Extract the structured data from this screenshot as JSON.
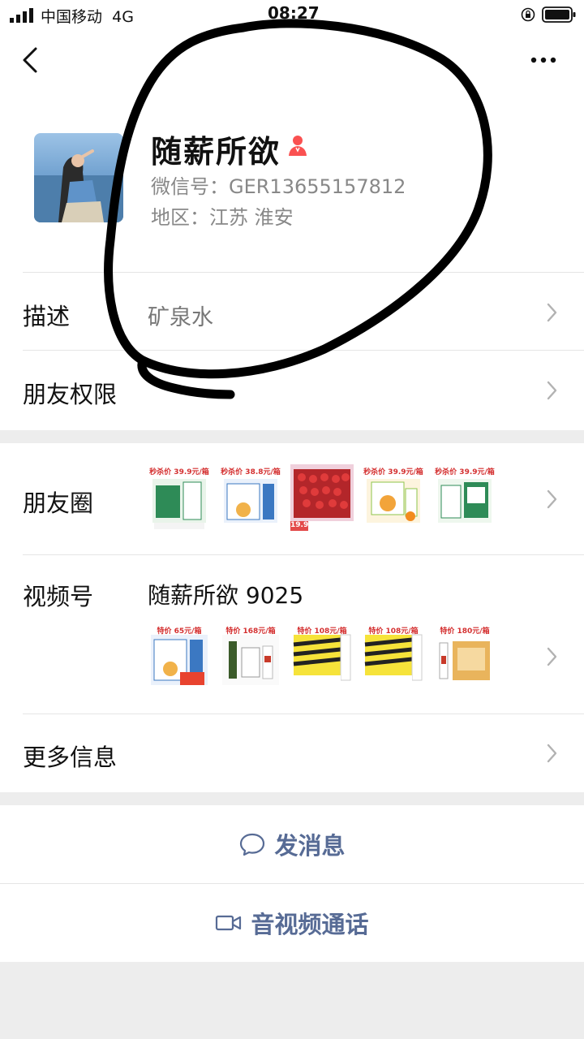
{
  "status_bar": {
    "carrier": "中国移动",
    "network": "4G",
    "time": "08:27"
  },
  "profile": {
    "nickname": "随薪所欲",
    "wechat_id": "微信号：GER13655157812",
    "region": "地区：江苏 淮安",
    "gender_color": "#fa5151"
  },
  "rows": {
    "description": {
      "label": "描述",
      "value": "矿泉水"
    },
    "permissions": {
      "label": "朋友权限"
    },
    "moments": {
      "label": "朋友圈",
      "thumbs": [
        "秒杀价 39.9元/箱",
        "秒杀价 38.8元/箱",
        "19.9",
        "秒杀价 39.9元/箱",
        "秒杀价 39.9元/箱"
      ]
    },
    "channels": {
      "label": "视频号",
      "value": "随薪所欲 9025",
      "thumbs": [
        "特价 65元/箱",
        "特价 168元/箱",
        "特价 108元/箱",
        "特价 108元/箱",
        "特价 180元/箱"
      ]
    },
    "more_info": {
      "label": "更多信息"
    }
  },
  "actions": {
    "message": "发消息",
    "call": "音视频通话"
  },
  "colors": {
    "link": "#576b95",
    "background": "#ededed",
    "separator": "#e5e5e5",
    "scribble": "#000000"
  }
}
